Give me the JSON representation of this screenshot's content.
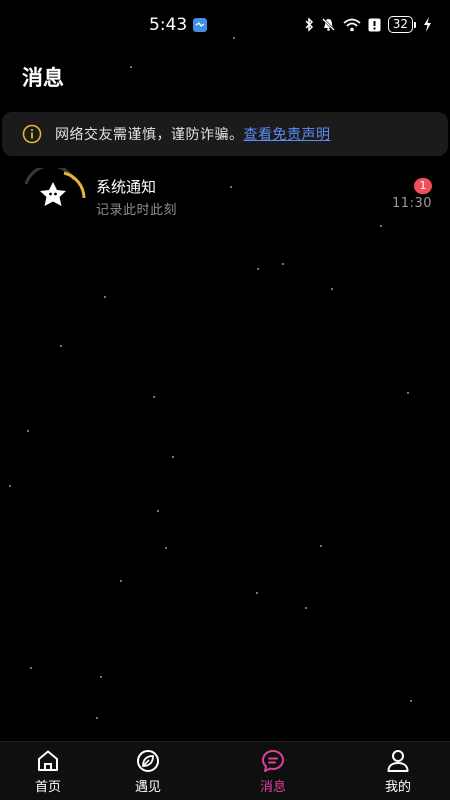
{
  "status_bar": {
    "time": "5:43",
    "battery": "32",
    "icons": [
      "bluetooth-icon",
      "mute-icon",
      "wifi-icon",
      "alert-icon",
      "battery-icon",
      "charging-icon"
    ]
  },
  "page": {
    "title": "消息"
  },
  "notice": {
    "text": "网络交友需谨慎，谨防诈骗。",
    "link": "查看免责声明",
    "icon": "info-icon"
  },
  "messages": [
    {
      "title": "系统通知",
      "subtitle": "记录此时此刻",
      "time": "11:30",
      "badge": "1",
      "icon": "star-avatar-icon"
    }
  ],
  "tabs": [
    {
      "label": "首页",
      "icon": "home-icon",
      "active": false
    },
    {
      "label": "遇见",
      "icon": "leaf-icon",
      "active": false
    },
    {
      "label": "消息",
      "icon": "chat-icon",
      "active": true
    },
    {
      "label": "我的",
      "icon": "profile-icon",
      "active": false
    }
  ],
  "colors": {
    "background": "#000000",
    "accent": "#e0409b",
    "link": "#5b8df5",
    "badge": "#f24e5a",
    "notice_bg": "#1b1b1b"
  }
}
